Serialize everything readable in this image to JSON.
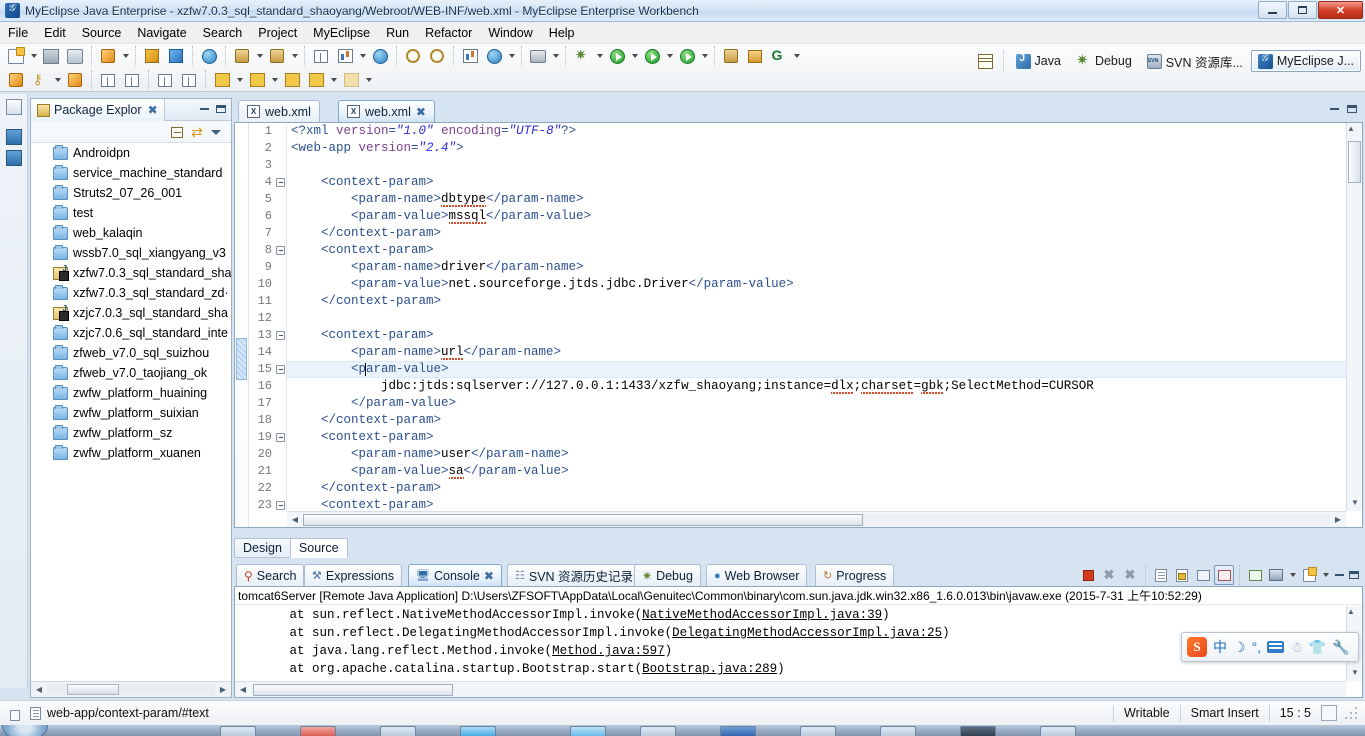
{
  "window": {
    "title": "MyEclipse Java Enterprise - xzfw7.0.3_sql_standard_shaoyang/Webroot/WEB-INF/web.xml - MyEclipse Enterprise Workbench",
    "app_icon": "myeclipse-icon",
    "minimize_label": "—",
    "restore_label": "❐",
    "close_label": "✕"
  },
  "menubar": {
    "items": [
      {
        "label": "File"
      },
      {
        "label": "Edit"
      },
      {
        "label": "Source"
      },
      {
        "label": "Navigate"
      },
      {
        "label": "Search"
      },
      {
        "label": "Project"
      },
      {
        "label": "MyEclipse"
      },
      {
        "label": "Run"
      },
      {
        "label": "Refactor"
      },
      {
        "label": "Window"
      },
      {
        "label": "Help"
      }
    ]
  },
  "perspective_bar": {
    "open_perspective_label": "open-perspective-icon",
    "items": [
      {
        "label": "Java",
        "icon": "java-perspective-icon",
        "active": false
      },
      {
        "label": "Debug",
        "icon": "debug-perspective-icon",
        "active": false
      },
      {
        "label": "SVN 资源库...",
        "icon": "svn-perspective-icon",
        "active": false
      },
      {
        "label": "MyEclipse J...",
        "icon": "myeclipse-perspective-icon",
        "active": true
      }
    ]
  },
  "package_explorer": {
    "tab_label": "Package Explor",
    "tab_icon": "package-explorer-icon",
    "close_label": "✖",
    "toolbar": {
      "collapse_all": "collapse-all-icon",
      "link_with_editor": "link-with-editor-icon",
      "view_menu": "view-menu-icon"
    },
    "tree_items": [
      {
        "label": "Androidpn",
        "icon": "folder-icon"
      },
      {
        "label": "service_machine_standard",
        "icon": "folder-icon"
      },
      {
        "label": "Struts2_07_26_001",
        "icon": "folder-icon"
      },
      {
        "label": "test",
        "icon": "folder-icon"
      },
      {
        "label": "web_kalaqin",
        "icon": "folder-icon"
      },
      {
        "label": "wssb7.0_sql_xiangyang_v3",
        "icon": "folder-icon"
      },
      {
        "label": "xzfw7.0.3_sql_standard_sha",
        "icon": "java-project-icon"
      },
      {
        "label": "xzfw7.0.3_sql_standard_zd·",
        "icon": "folder-icon"
      },
      {
        "label": "xzjc7.0.3_sql_standard_sha",
        "icon": "java-project-icon"
      },
      {
        "label": "xzjc7.0.6_sql_standard_inte",
        "icon": "folder-icon"
      },
      {
        "label": "zfweb_v7.0_sql_suizhou",
        "icon": "folder-icon"
      },
      {
        "label": "zfweb_v7.0_taojiang_ok",
        "icon": "folder-icon"
      },
      {
        "label": "zwfw_platform_huaining",
        "icon": "folder-icon"
      },
      {
        "label": "zwfw_platform_suixian",
        "icon": "folder-icon"
      },
      {
        "label": "zwfw_platform_sz",
        "icon": "folder-icon"
      },
      {
        "label": "zwfw_platform_xuanen",
        "icon": "folder-icon"
      }
    ]
  },
  "editor": {
    "tabs": [
      {
        "label": "web.xml",
        "icon": "xml-file-icon",
        "active": false,
        "closable": false
      },
      {
        "label": "web.xml",
        "icon": "xml-file-icon",
        "active": true,
        "closable": true,
        "close_label": "✖"
      }
    ],
    "bottom_tabs": [
      {
        "label": "Design",
        "active": false
      },
      {
        "label": "Source",
        "active": true
      }
    ],
    "highlighted_line": 15,
    "lines": [
      {
        "n": 1,
        "fold": false,
        "segments": [
          {
            "t": "tag",
            "v": "<?xml "
          },
          {
            "t": "attr",
            "v": "version"
          },
          {
            "t": "tag",
            "v": "="
          },
          {
            "t": "val",
            "v": "\"1.0\""
          },
          {
            "t": "tag",
            "v": " "
          },
          {
            "t": "attr",
            "v": "encoding"
          },
          {
            "t": "tag",
            "v": "="
          },
          {
            "t": "val",
            "v": "\"UTF-8\""
          },
          {
            "t": "tag",
            "v": "?>"
          }
        ]
      },
      {
        "n": 2,
        "fold": false,
        "segments": [
          {
            "t": "tag",
            "v": "<web-app "
          },
          {
            "t": "attr",
            "v": "version"
          },
          {
            "t": "tag",
            "v": "="
          },
          {
            "t": "val",
            "v": "\"2.4\""
          },
          {
            "t": "tag",
            "v": ">"
          }
        ]
      },
      {
        "n": 3,
        "fold": false,
        "segments": []
      },
      {
        "n": 4,
        "fold": true,
        "segments": [
          {
            "t": "tag",
            "v": "    <context-param>"
          }
        ]
      },
      {
        "n": 5,
        "fold": false,
        "segments": [
          {
            "t": "tag",
            "v": "        <param-name>"
          },
          {
            "t": "txs",
            "v": "dbtype"
          },
          {
            "t": "tag",
            "v": "</param-name>"
          }
        ]
      },
      {
        "n": 6,
        "fold": false,
        "segments": [
          {
            "t": "tag",
            "v": "        <param-value>"
          },
          {
            "t": "txs",
            "v": "mssql"
          },
          {
            "t": "tag",
            "v": "</param-value>"
          }
        ]
      },
      {
        "n": 7,
        "fold": false,
        "segments": [
          {
            "t": "tag",
            "v": "    </context-param>"
          }
        ]
      },
      {
        "n": 8,
        "fold": true,
        "segments": [
          {
            "t": "tag",
            "v": "    <context-param>"
          }
        ]
      },
      {
        "n": 9,
        "fold": false,
        "segments": [
          {
            "t": "tag",
            "v": "        <param-name>"
          },
          {
            "t": "text",
            "v": "driver"
          },
          {
            "t": "tag",
            "v": "</param-name>"
          }
        ]
      },
      {
        "n": 10,
        "fold": false,
        "segments": [
          {
            "t": "tag",
            "v": "        <param-value>"
          },
          {
            "t": "text",
            "v": "net.sourceforge.jtds.jdbc.Driver"
          },
          {
            "t": "tag",
            "v": "</param-value>"
          }
        ]
      },
      {
        "n": 11,
        "fold": false,
        "segments": [
          {
            "t": "tag",
            "v": "    </context-param>"
          }
        ]
      },
      {
        "n": 12,
        "fold": false,
        "segments": []
      },
      {
        "n": 13,
        "fold": true,
        "segments": [
          {
            "t": "tag",
            "v": "    <context-param>"
          }
        ]
      },
      {
        "n": 14,
        "fold": false,
        "segments": [
          {
            "t": "tag",
            "v": "        <param-name>"
          },
          {
            "t": "txs",
            "v": "url"
          },
          {
            "t": "tag",
            "v": "</param-name>"
          }
        ]
      },
      {
        "n": 15,
        "fold": true,
        "segments": [
          {
            "t": "tag",
            "v": "        <param-value>"
          }
        ]
      },
      {
        "n": 16,
        "fold": false,
        "segments": [
          {
            "t": "text",
            "v": "            jdbc:jtds:sqlserver://127.0.0.1:1433/xzfw_shaoyang;instance="
          },
          {
            "t": "txs",
            "v": "dlx"
          },
          {
            "t": "text",
            "v": ";"
          },
          {
            "t": "txs",
            "v": "charset"
          },
          {
            "t": "text",
            "v": "="
          },
          {
            "t": "txs",
            "v": "gbk"
          },
          {
            "t": "text",
            "v": ";SelectMethod=CURSOR"
          }
        ]
      },
      {
        "n": 17,
        "fold": false,
        "segments": [
          {
            "t": "tag",
            "v": "        </param-value>"
          }
        ]
      },
      {
        "n": 18,
        "fold": false,
        "segments": [
          {
            "t": "tag",
            "v": "    </context-param>"
          }
        ]
      },
      {
        "n": 19,
        "fold": true,
        "segments": [
          {
            "t": "tag",
            "v": "    <context-param>"
          }
        ]
      },
      {
        "n": 20,
        "fold": false,
        "segments": [
          {
            "t": "tag",
            "v": "        <param-name>"
          },
          {
            "t": "text",
            "v": "user"
          },
          {
            "t": "tag",
            "v": "</param-name>"
          }
        ]
      },
      {
        "n": 21,
        "fold": false,
        "segments": [
          {
            "t": "tag",
            "v": "        <param-value>"
          },
          {
            "t": "txs",
            "v": "sa"
          },
          {
            "t": "tag",
            "v": "</param-value>"
          }
        ]
      },
      {
        "n": 22,
        "fold": false,
        "segments": [
          {
            "t": "tag",
            "v": "    </context-param>"
          }
        ]
      },
      {
        "n": 23,
        "fold": true,
        "segments": [
          {
            "t": "tag",
            "v": "    <context-param>"
          }
        ]
      }
    ]
  },
  "console": {
    "tabs": [
      {
        "label": "Search",
        "icon": "search-icon",
        "active": false
      },
      {
        "label": "Expressions",
        "icon": "expressions-icon",
        "active": false
      },
      {
        "label": "Console",
        "icon": "console-icon",
        "active": true,
        "close_label": "✖"
      },
      {
        "label": "SVN 资源历史记录",
        "icon": "svn-history-icon",
        "active": false
      },
      {
        "label": "Debug",
        "icon": "debug-icon",
        "active": false
      },
      {
        "label": "Web Browser",
        "icon": "web-browser-icon",
        "active": false
      },
      {
        "label": "Progress",
        "icon": "progress-icon",
        "active": false
      }
    ],
    "process_header": "tomcat6Server [Remote Java Application] D:\\Users\\ZFSOFT\\AppData\\Local\\Genuitec\\Common\\binary\\com.sun.java.jdk.win32.x86_1.6.0.013\\bin\\javaw.exe (2015-7-31 上午10:52:29)",
    "output_lines": [
      {
        "pre": "       at sun.reflect.NativeMethodAccessorImpl.invoke(",
        "link": "NativeMethodAccessorImpl.java:39",
        "post": ")"
      },
      {
        "pre": "       at sun.reflect.DelegatingMethodAccessorImpl.invoke(",
        "link": "DelegatingMethodAccessorImpl.java:25",
        "post": ")"
      },
      {
        "pre": "       at java.lang.reflect.Method.invoke(",
        "link": "Method.java:597",
        "post": ")"
      },
      {
        "pre": "       at org.apache.catalina.startup.Bootstrap.start(",
        "link": "Bootstrap.java:289",
        "post": ")"
      }
    ],
    "toolbar": [
      {
        "name": "terminate-button",
        "icon": "stop-icon"
      },
      {
        "name": "remove-launch-button",
        "icon": "remove-icon"
      },
      {
        "name": "remove-all-terminated-button",
        "icon": "remove-all-icon"
      },
      {
        "name": "clear-console-button",
        "icon": "clear-console-icon"
      },
      {
        "name": "scroll-lock-button",
        "icon": "scroll-lock-icon"
      },
      {
        "name": "word-wrap-button",
        "icon": "word-wrap-icon"
      },
      {
        "name": "pin-console-button",
        "icon": "pin-console-icon"
      },
      {
        "name": "open-console-button",
        "icon": "open-console-icon"
      },
      {
        "name": "display-selected-console-button",
        "icon": "display-console-icon"
      },
      {
        "name": "new-console-view-button",
        "icon": "new-console-icon"
      }
    ]
  },
  "ime": {
    "name": "sogou-input-method-toolbar",
    "logo": "S",
    "items": [
      {
        "icon": "chinese-mode-icon",
        "label": "中"
      },
      {
        "icon": "moon-icon",
        "label": "☽"
      },
      {
        "icon": "punctuation-icon",
        "label": "°,"
      },
      {
        "icon": "soft-keyboard-icon",
        "label": ""
      },
      {
        "icon": "user-icon",
        "label": ""
      },
      {
        "icon": "skin-icon",
        "label": ""
      },
      {
        "icon": "toolbox-icon",
        "label": ""
      }
    ]
  },
  "statusbar": {
    "xpath": "web-app/context-param/#text",
    "writable": "Writable",
    "insert_mode": "Smart Insert",
    "cursor_position": "15 : 5"
  },
  "colors": {
    "tag": "#2b4f8e",
    "attribute": "#7b3f8f",
    "attribute_value": "#2a2adf",
    "text": "#000000",
    "highlight_line": "#eaf2fb",
    "accent": "#3a6ea5",
    "close_red": "#cf3b22"
  }
}
